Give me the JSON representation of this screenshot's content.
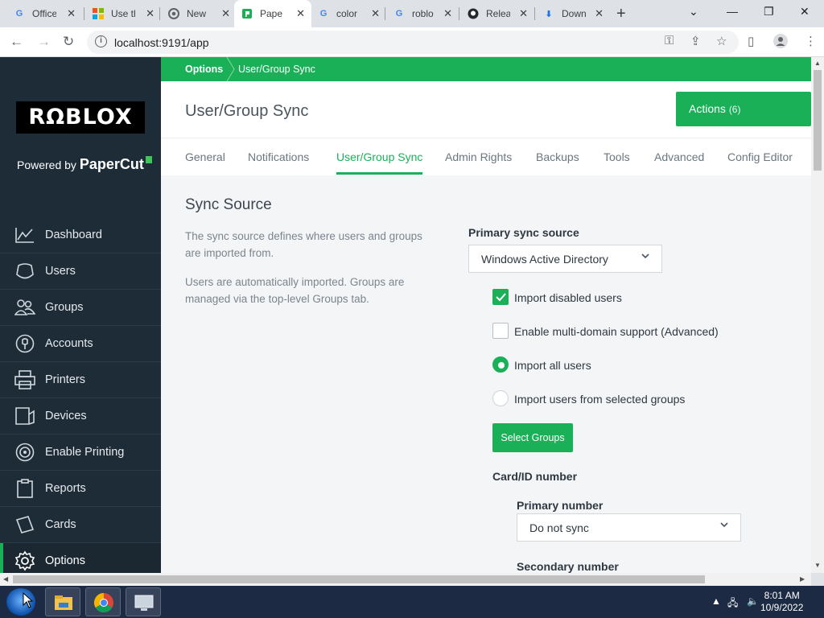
{
  "browser": {
    "tabs": [
      {
        "title": "Office",
        "icon": "google-icon",
        "active": false
      },
      {
        "title": "Use th",
        "icon": "microsoft-icon",
        "active": false
      },
      {
        "title": "New",
        "icon": "chrome-icon",
        "active": false
      },
      {
        "title": "Pape",
        "icon": "papercut-icon",
        "active": true
      },
      {
        "title": "color",
        "icon": "google-icon",
        "active": false
      },
      {
        "title": "roblo",
        "icon": "google-icon",
        "active": false
      },
      {
        "title": "Relea",
        "icon": "github-icon",
        "active": false
      },
      {
        "title": "Down",
        "icon": "download-icon",
        "active": false
      }
    ],
    "url": "localhost:9191/app"
  },
  "sidebar": {
    "logo": "RΩBLOX",
    "powered_prefix": "Powered by",
    "powered_brand": "PaperCut",
    "items": [
      {
        "label": "Dashboard",
        "icon": "dashboard-chart-icon"
      },
      {
        "label": "Users",
        "icon": "user-icon"
      },
      {
        "label": "Groups",
        "icon": "group-icon"
      },
      {
        "label": "Accounts",
        "icon": "account-icon"
      },
      {
        "label": "Printers",
        "icon": "printer-icon"
      },
      {
        "label": "Devices",
        "icon": "device-icon"
      },
      {
        "label": "Enable Printing",
        "icon": "release-icon"
      },
      {
        "label": "Reports",
        "icon": "report-icon"
      },
      {
        "label": "Cards",
        "icon": "card-icon"
      },
      {
        "label": "Options",
        "icon": "gear-icon",
        "active": true
      }
    ]
  },
  "breadcrumb": {
    "root": "Options",
    "current": "User/Group Sync"
  },
  "page": {
    "title": "User/Group Sync",
    "actions_label": "Actions",
    "actions_count": "(6)"
  },
  "tabs": [
    "General",
    "Notifications",
    "User/Group Sync",
    "Admin Rights",
    "Backups",
    "Tools",
    "Advanced",
    "Config Editor"
  ],
  "active_tab": "User/Group Sync",
  "sync": {
    "section_title": "Sync Source",
    "desc1": "The sync source defines where users and groups are imported from.",
    "desc2": "Users are automatically imported. Groups are managed via the top-level Groups tab.",
    "primary_label": "Primary sync source",
    "primary_value": "Windows Active Directory",
    "options": [
      {
        "label": "Import disabled users",
        "type": "checkbox",
        "checked": true
      },
      {
        "label": "Enable multi-domain support (Advanced)",
        "type": "checkbox",
        "checked": false
      },
      {
        "label": "Import all users",
        "type": "radio",
        "checked": true
      },
      {
        "label": "Import users from selected groups",
        "type": "radio",
        "checked": false
      }
    ],
    "select_groups_label": "Select Groups",
    "card_label": "Card/ID number",
    "primary_number_label": "Primary number",
    "primary_number_value": "Do not sync",
    "secondary_number_label": "Secondary number"
  },
  "taskbar": {
    "time": "8:01 AM",
    "date": "10/9/2022"
  },
  "colors": {
    "brand_green": "#1ab058",
    "sidebar_bg": "#1e2c38"
  }
}
